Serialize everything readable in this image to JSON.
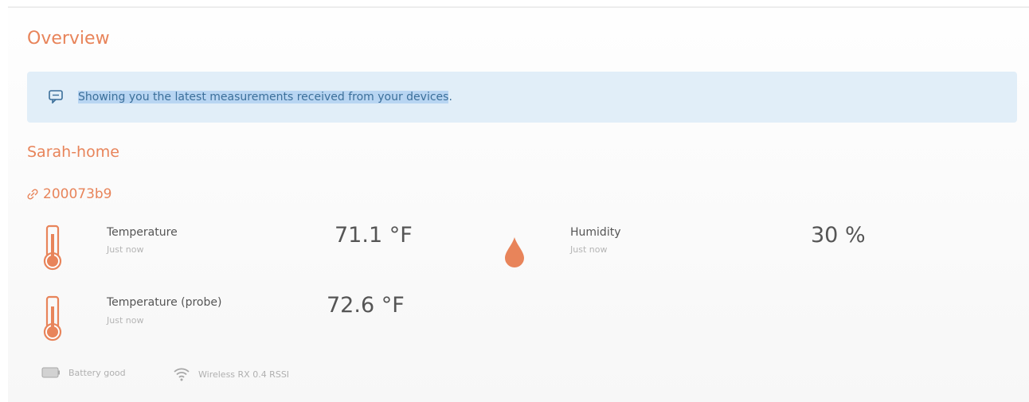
{
  "header": {
    "title": "Overview"
  },
  "banner": {
    "text": "Showing you the latest measurements received from your devices",
    "text_end": "."
  },
  "location": {
    "name": "Sarah-home"
  },
  "device": {
    "id": "200073b9"
  },
  "measurements": [
    {
      "label": "Temperature",
      "time": "Just now",
      "value": "71.1 °F",
      "icon": "thermometer-icon"
    },
    {
      "label": "Humidity",
      "time": "Just now",
      "value": "30 %",
      "icon": "humidity-drop-icon"
    },
    {
      "label": "Temperature (probe)",
      "time": "Just now",
      "value": "72.6 °F",
      "icon": "thermometer-icon"
    }
  ],
  "status": {
    "battery": "Battery good",
    "wireless": "Wireless RX 0.4 RSSI"
  },
  "colors": {
    "accent": "#e8845a",
    "banner_bg": "#e1eef8",
    "banner_text": "#3b6f9a"
  }
}
